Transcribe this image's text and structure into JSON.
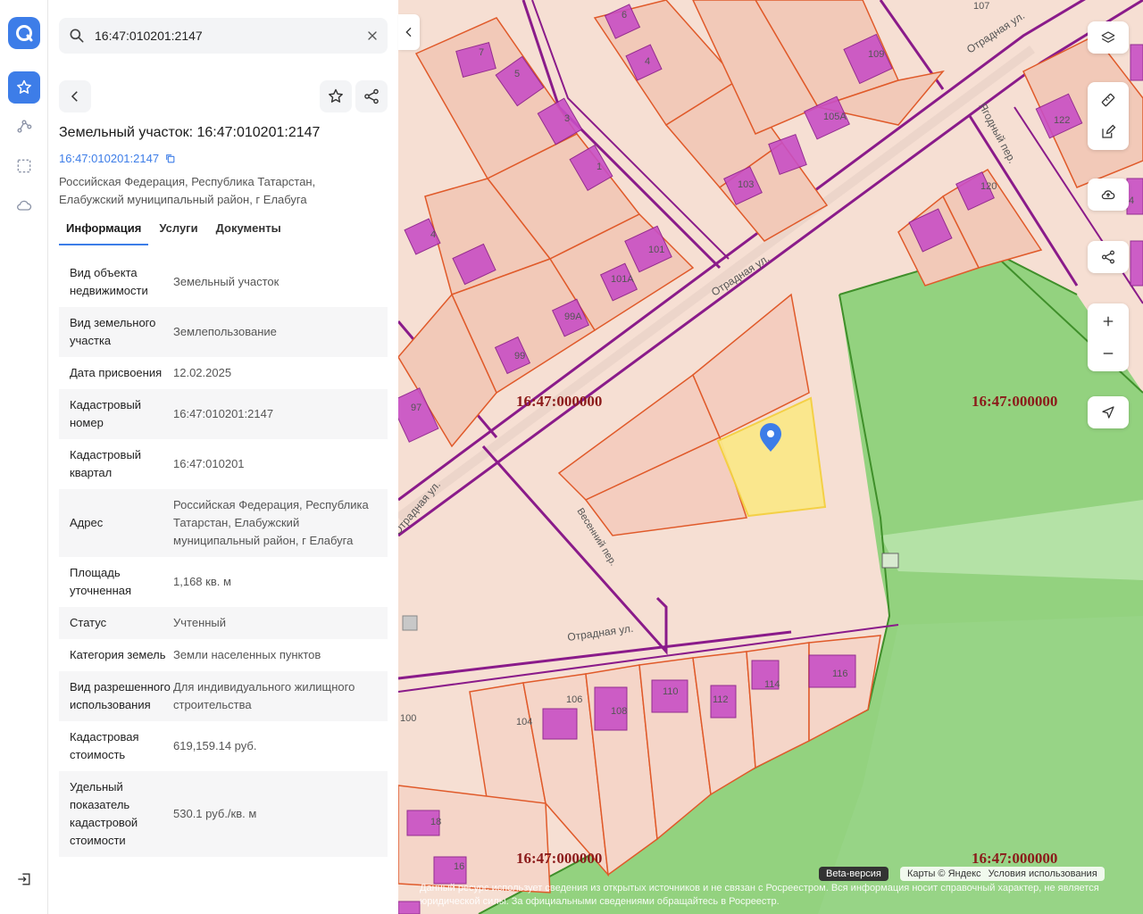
{
  "search": {
    "value": "16:47:010201:2147"
  },
  "object": {
    "title": "Земельный участок: 16:47:010201:2147",
    "cad_link": "16:47:010201:2147",
    "address": "Российская Федерация, Республика Татарстан, Елабужский муниципальный район, г Елабуга"
  },
  "tabs": [
    "Информация",
    "Услуги",
    "Документы"
  ],
  "info": [
    {
      "k": "Вид объекта недвижимости",
      "v": "Земельный участок"
    },
    {
      "k": "Вид земельного участка",
      "v": "Землепользование"
    },
    {
      "k": "Дата присвоения",
      "v": "12.02.2025"
    },
    {
      "k": "Кадастровый номер",
      "v": "16:47:010201:2147"
    },
    {
      "k": "Кадастровый квартал",
      "v": "16:47:010201"
    },
    {
      "k": "Адрес",
      "v": "Российская Федерация, Республика Татарстан, Елабужский муниципальный район, г Елабуга"
    },
    {
      "k": "Площадь уточненная",
      "v": "1,168 кв. м"
    },
    {
      "k": "Статус",
      "v": "Учтенный"
    },
    {
      "k": "Категория земель",
      "v": "Земли населенных пунктов"
    },
    {
      "k": "Вид разрешенного использования",
      "v": "Для индивидуального жилищного строительства"
    },
    {
      "k": "Кадастровая стоимость",
      "v": "619,159.14 руб."
    },
    {
      "k": "Удельный показатель кадастровой стоимости",
      "v": "530.1 руб./кв. м"
    }
  ],
  "map": {
    "quarter_labels": [
      "16:47:000000",
      "16:47:000000",
      "16:47:000000",
      "16:47:000000"
    ],
    "streets": [
      "Отрадная ул.",
      "Отрадная ул.",
      "Отрадная ул.",
      "Отрадная ул.",
      "Ягодный пер.",
      "Весенний пер."
    ],
    "house_numbers": [
      "107",
      "6",
      "7",
      "5",
      "4",
      "109",
      "3",
      "1",
      "105А",
      "122",
      "103",
      "120",
      "4",
      "101",
      "101А",
      "99А",
      "99",
      "97",
      "100",
      "104",
      "106",
      "108",
      "110",
      "112",
      "114",
      "116",
      "18",
      "16",
      "4"
    ],
    "beta_label": "Beta-версия",
    "attribution": "Карты © Яндекс",
    "terms": "Условия использования",
    "disclaimer": "Данный ресурс использует сведения из открытых источников и не связан с Росреестром. Вся информация носит справочный характер, не является юридической силы. За официальными сведениями обращайтесь в Росреестр."
  },
  "colors": {
    "accent": "#3d7de8",
    "parcel": "#e05a2a",
    "quarter": "#8a1b8a",
    "selected": "#fbe88a",
    "forest": "#93d27f"
  }
}
